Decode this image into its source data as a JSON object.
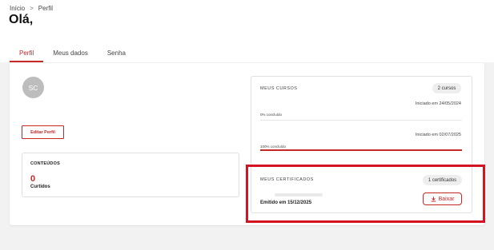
{
  "breadcrumb": {
    "home": "Início",
    "separator": ">",
    "current": "Perfil"
  },
  "greeting": "Olá,",
  "tabs": [
    {
      "label": "Perfil",
      "active": true
    },
    {
      "label": "Meus dados"
    },
    {
      "label": "Senha"
    }
  ],
  "profile": {
    "avatar_initials": "SC",
    "edit_label": "Editar Perfil",
    "content": {
      "label": "CONTEÚDOS",
      "count": "0",
      "sub_label": "Curtidos"
    }
  },
  "courses": {
    "title": "MEUS CURSOS",
    "count_label": "2 cursos",
    "items": [
      {
        "started": "Iniciado em 24/05/2024",
        "progress_label": "0% concluído",
        "progress": 0
      },
      {
        "started": "Iniciado em 02/07/2025",
        "progress_label": "100% concluído",
        "progress": 1
      }
    ]
  },
  "certificates": {
    "title": "MEUS CERTIFICADOS",
    "count_label": "1 certificados",
    "items": [
      {
        "issued": "Emitido em 15/12/2025",
        "download_label": "Baixar"
      }
    ]
  },
  "colors": {
    "accent": "#c62828",
    "highlight": "#d3131f"
  }
}
